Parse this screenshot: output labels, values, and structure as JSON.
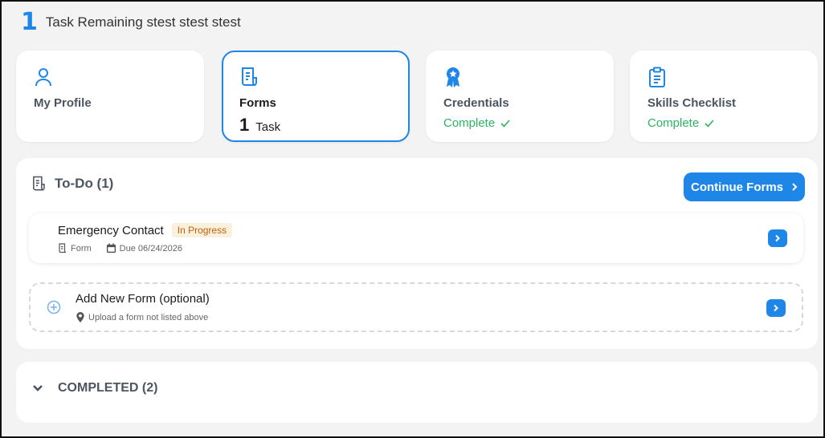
{
  "header": {
    "count": "1",
    "label": "Task Remaining stest stest stest"
  },
  "cards": [
    {
      "title": "My Profile",
      "icon": "person-icon"
    },
    {
      "title": "Forms",
      "icon": "document-icon",
      "task_count": "1",
      "task_label": "Task"
    },
    {
      "title": "Credentials",
      "icon": "ribbon-award-icon",
      "status": "Complete"
    },
    {
      "title": "Skills Checklist",
      "icon": "clipboard-icon",
      "status": "Complete"
    }
  ],
  "todo": {
    "title": "To-Do (1)",
    "continue_label": "Continue Forms",
    "items": [
      {
        "name": "Emergency Contact",
        "badge": "In Progress",
        "type": "Form",
        "due": "Due 06/24/2026"
      }
    ],
    "add": {
      "name": "Add New Form (optional)",
      "hint": "Upload a form not listed above"
    }
  },
  "completed": {
    "title": "COMPLETED (2)"
  },
  "colors": {
    "accent": "#1e86e6",
    "success": "#2cb462",
    "badge_bg": "#fbf0dc",
    "badge_text": "#c0620f"
  }
}
